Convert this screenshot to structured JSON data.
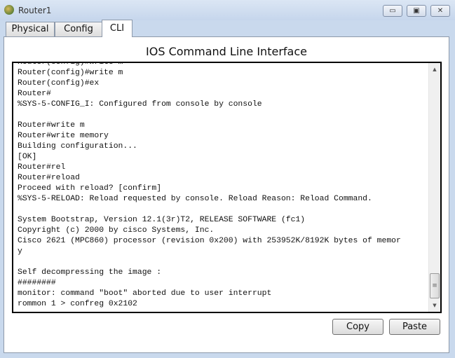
{
  "window": {
    "title": "Router1",
    "controls": {
      "minimize": "▭",
      "maximize": "▣",
      "close": "✕"
    }
  },
  "tabs": [
    {
      "label": "Physical"
    },
    {
      "label": "Config"
    },
    {
      "label": "CLI",
      "active": true
    }
  ],
  "cli": {
    "title": "IOS Command Line Interface",
    "lines": [
      "Router(config)#write m",
      "Router(config)#write m",
      "Router(config)#ex",
      "Router#",
      "%SYS-5-CONFIG_I: Configured from console by console",
      "",
      "Router#write m",
      "Router#write memory",
      "Building configuration...",
      "[OK]",
      "Router#rel",
      "Router#reload",
      "Proceed with reload? [confirm]",
      "%SYS-5-RELOAD: Reload requested by console. Reload Reason: Reload Command.",
      "",
      "System Bootstrap, Version 12.1(3r)T2, RELEASE SOFTWARE (fc1)",
      "Copyright (c) 2000 by cisco Systems, Inc.",
      "Cisco 2621 (MPC860) processor (revision 0x200) with 253952K/8192K bytes of memor",
      "y",
      "",
      "Self decompressing the image :",
      "########",
      "monitor: command \"boot\" aborted due to user interrupt",
      "rommon 1 > confreg 0x2102"
    ],
    "scroll_position": 1.0
  },
  "buttons": {
    "copy": "Copy",
    "paste": "Paste"
  }
}
